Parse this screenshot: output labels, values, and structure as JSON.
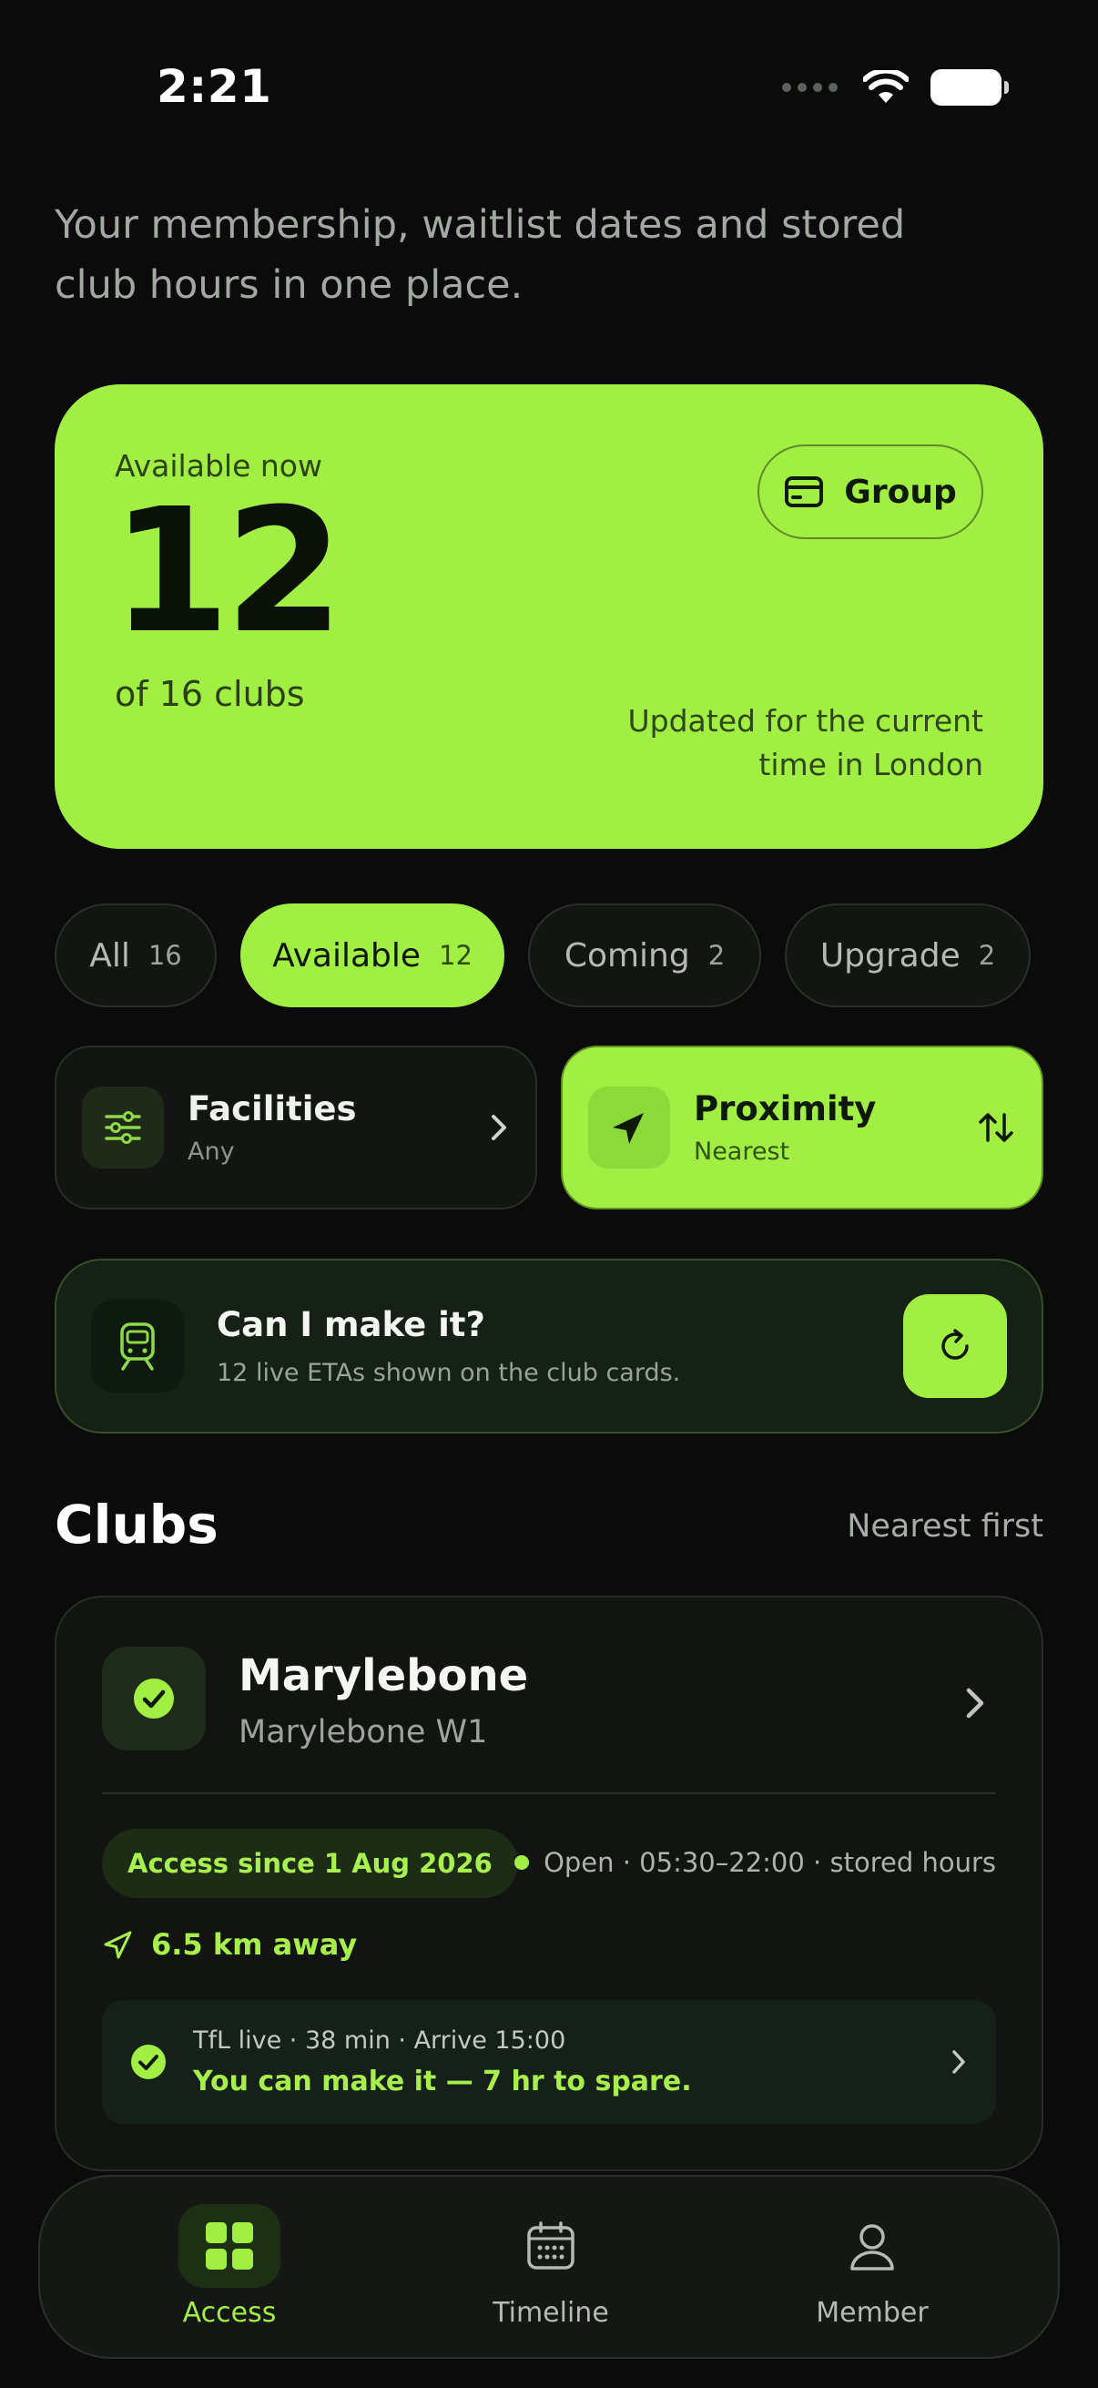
{
  "status": {
    "time": "2:21"
  },
  "intro": "Your membership, waitlist dates and stored club hours in one place.",
  "hero": {
    "label": "Available now",
    "count": "12",
    "sub": "of 16 clubs",
    "note": "Updated for the current time in London",
    "group_label": "Group"
  },
  "filters": [
    {
      "label": "All",
      "count": "16"
    },
    {
      "label": "Available",
      "count": "12"
    },
    {
      "label": "Coming",
      "count": "2"
    },
    {
      "label": "Upgrade",
      "count": "2"
    }
  ],
  "facilities": {
    "title": "Facilities",
    "value": "Any"
  },
  "proximity": {
    "title": "Proximity",
    "value": "Nearest"
  },
  "eta": {
    "title": "Can I make it?",
    "subtitle": "12 live ETAs shown on the club cards."
  },
  "clubs_section": {
    "title": "Clubs",
    "sort": "Nearest first"
  },
  "club": {
    "name": "Marylebone",
    "location": "Marylebone W1",
    "badge": "Access since 1 Aug 2026",
    "hours": "Open · 05:30–22:00 · stored hours",
    "distance": "6.5 km away",
    "tfl_line": "TfL live · 38 min · Arrive 15:00",
    "tfl_result": "You can make it — 7 hr to spare."
  },
  "nav": [
    {
      "label": "Access"
    },
    {
      "label": "Timeline"
    },
    {
      "label": "Member"
    }
  ],
  "colors": {
    "accent": "#a1ef42",
    "background": "#0a0b0a",
    "card": "#121412"
  }
}
